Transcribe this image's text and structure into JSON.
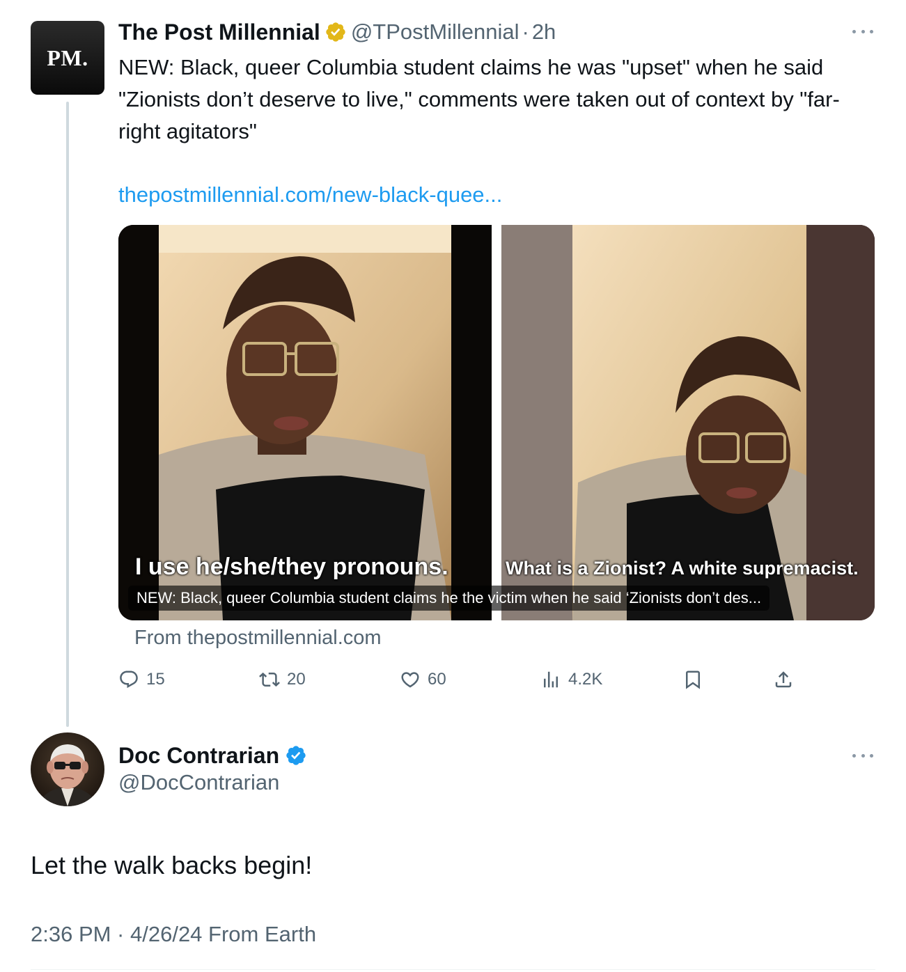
{
  "parent_tweet": {
    "avatar_text": "PM.",
    "display_name": "The Post Millennial",
    "verified": "gold",
    "handle": "@TPostMillennial",
    "separator": "·",
    "time": "2h",
    "text": "NEW: Black, queer Columbia student claims he was \"upset\" when he said \"Zionists don’t deserve to live,\" comments were taken out of context by \"far-right agitators\"",
    "link": "thepostmillennial.com/new-black-quee...",
    "media": {
      "subtitle_left": "I use he/she/they pronouns.",
      "subtitle_right": "What is a Zionist? A white supremacist.",
      "card_caption": "NEW: Black, queer Columbia student claims he the victim when he said ‘Zionists don’t des...",
      "source": "From thepostmillennial.com"
    },
    "actions": {
      "replies": "15",
      "reposts": "20",
      "likes": "60",
      "views": "4.2K"
    }
  },
  "reply_tweet": {
    "display_name": "Doc Contrarian",
    "verified": "blue",
    "handle": "@DocContrarian",
    "text": "Let the walk backs begin!",
    "meta": "2:36 PM · 4/26/24 From Earth"
  },
  "colors": {
    "text_primary": "#0f1419",
    "text_secondary": "#536471",
    "link": "#1d9bf0",
    "gold_badge": "#e2b719",
    "blue_badge": "#1d9bf0",
    "thread_line": "#cfd9de"
  }
}
